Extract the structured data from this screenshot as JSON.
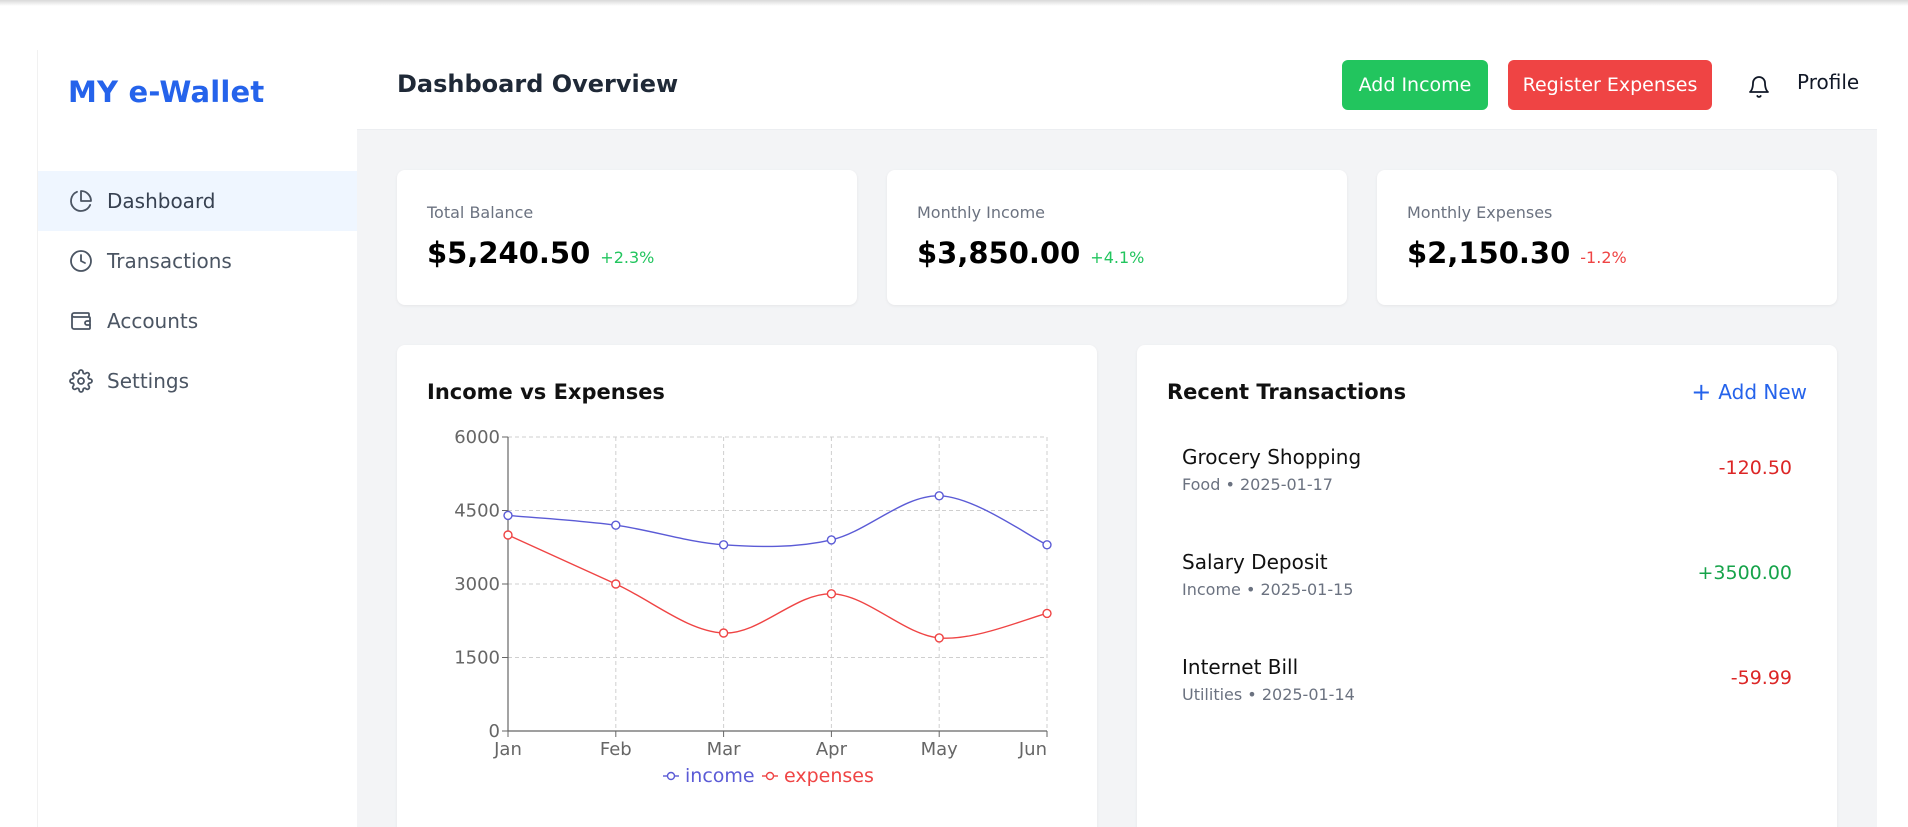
{
  "app": {
    "brand": "MY e-Wallet"
  },
  "sidebar": {
    "items": [
      {
        "label": "Dashboard",
        "icon": "pie-chart-icon",
        "active": true
      },
      {
        "label": "Transactions",
        "icon": "clock-icon",
        "active": false
      },
      {
        "label": "Accounts",
        "icon": "wallet-icon",
        "active": false
      },
      {
        "label": "Settings",
        "icon": "gear-icon",
        "active": false
      }
    ]
  },
  "header": {
    "title": "Dashboard Overview",
    "add_income_label": "Add Income",
    "register_expenses_label": "Register Expenses",
    "notifications_icon": "bell-icon",
    "profile_label": "Profile"
  },
  "stats": [
    {
      "label": "Total Balance",
      "value": "$5,240.50",
      "change": "+2.3%",
      "trend": "up"
    },
    {
      "label": "Monthly Income",
      "value": "$3,850.00",
      "change": "+4.1%",
      "trend": "up"
    },
    {
      "label": "Monthly Expenses",
      "value": "$2,150.30",
      "change": "-1.2%",
      "trend": "down"
    }
  ],
  "chart_section": {
    "title": "Income vs Expenses"
  },
  "chart_data": {
    "type": "line",
    "categories": [
      "Jan",
      "Feb",
      "Mar",
      "Apr",
      "May",
      "Jun"
    ],
    "series": [
      {
        "name": "income",
        "values": [
          4400,
          4200,
          3800,
          3900,
          4800,
          3800
        ],
        "color": "#5b5bd6"
      },
      {
        "name": "expenses",
        "values": [
          4000,
          3000,
          2000,
          2800,
          1900,
          2400
        ],
        "color": "#ef4444"
      }
    ],
    "y_ticks": [
      0,
      1500,
      3000,
      4500,
      6000
    ],
    "ylim": [
      0,
      6000
    ],
    "grid": true,
    "legend_position": "bottom"
  },
  "transactions": {
    "title": "Recent Transactions",
    "add_new_label": "Add New",
    "items": [
      {
        "title": "Grocery Shopping",
        "meta": "Food • 2025-01-17",
        "amount": "-120.50",
        "type": "debit"
      },
      {
        "title": "Salary Deposit",
        "meta": "Income • 2025-01-15",
        "amount": "+3500.00",
        "type": "credit"
      },
      {
        "title": "Internet Bill",
        "meta": "Utilities • 2025-01-14",
        "amount": "-59.99",
        "type": "debit"
      }
    ]
  }
}
